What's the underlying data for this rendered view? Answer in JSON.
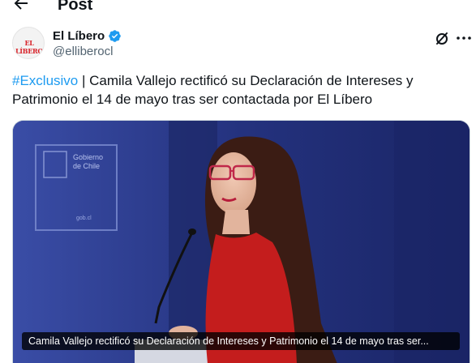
{
  "topbar": {
    "title": "Post"
  },
  "author": {
    "name": "El Líbero",
    "handle": "@elliberocl",
    "avatar_text": "EL LÍBERO",
    "verified": true
  },
  "tweet": {
    "hashtag": "#Exclusivo",
    "text": " | Camila Vallejo rectificó su Declaración de Intereses y Patrimonio el 14 de mayo tras ser contactada por El Líbero"
  },
  "media": {
    "sign_text_line1": "Gobierno",
    "sign_text_line2": "de Chile",
    "sign_url": "gob.cl",
    "caption": "Camila Vallejo rectificó su Declaración de Intereses y Patrimonio el 14 de mayo tras ser..."
  },
  "colors": {
    "accent": "#1d9bf0",
    "text": "#0f1419",
    "muted": "#536471",
    "backdrop": "#27358a",
    "dress": "#c41d1d"
  },
  "icons": [
    "back-arrow-icon",
    "verified-badge-icon",
    "grok-icon",
    "more-icon"
  ]
}
